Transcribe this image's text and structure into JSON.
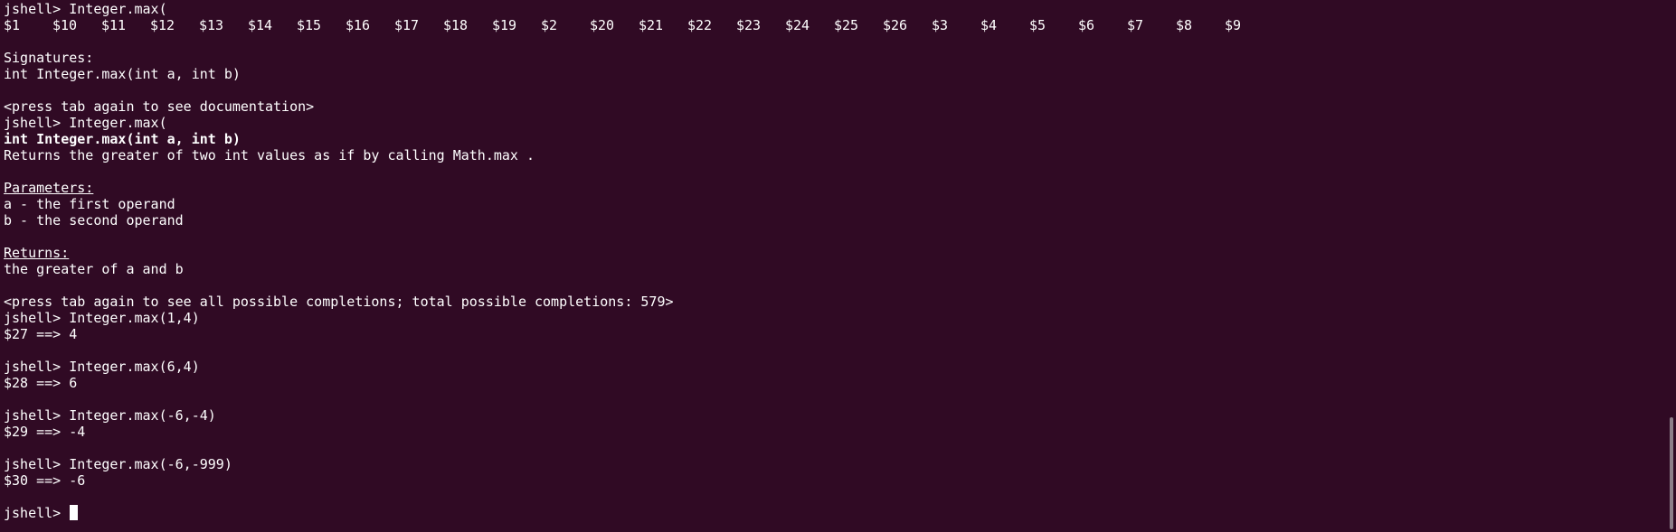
{
  "terminal": {
    "background": "#300a24",
    "foreground": "#ffffff",
    "lines": [
      "jshell> Integer.max(",
      "",
      "",
      "Signatures:",
      "int Integer.max(int a, int b)",
      "",
      "<press tab again to see documentation>",
      "jshell> Integer.max(",
      "int Integer.max(int a, int b)",
      "Returns the greater of two int values as if by calling Math.max .",
      "",
      "Parameters:",
      "a - the first operand",
      "b - the second operand",
      "",
      "Returns:",
      "the greater of a and b",
      "",
      "<press tab again to see all possible completions; total possible completions: 579>",
      "jshell> Integer.max(1,4)",
      "$27 ==> 4",
      "",
      "jshell> Integer.max(6,4)",
      "$28 ==> 6",
      "",
      "jshell> Integer.max(-6,-4)",
      "$29 ==> -4",
      "",
      "jshell> Integer.max(-6,-999)",
      "$30 ==> -6",
      "",
      "jshell> "
    ],
    "completion_vars": [
      "$1",
      "$10",
      "$11",
      "$12",
      "$13",
      "$14",
      "$15",
      "$16",
      "$17",
      "$18",
      "$19",
      "$2",
      "$20",
      "$21",
      "$22",
      "$23",
      "$24",
      "$25",
      "$26",
      "$3",
      "$4",
      "$5",
      "$6",
      "$7",
      "$8",
      "$9"
    ]
  }
}
